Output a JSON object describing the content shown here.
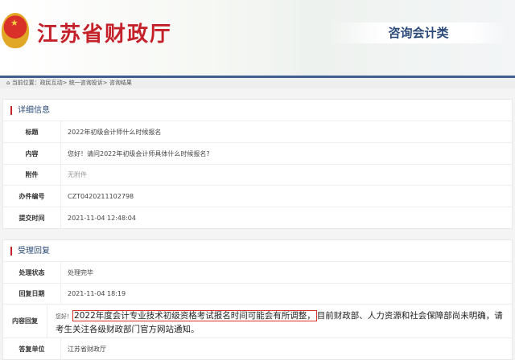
{
  "header": {
    "site_title": "江苏省财政厅",
    "category": "咨询会计类"
  },
  "breadcrumb": {
    "icon": "home-icon",
    "text": "当前位置：政民互动> 统一咨询投诉> 咨询结果"
  },
  "detail": {
    "title": "详细信息",
    "rows": [
      {
        "label": "标题",
        "value": "2022年初级会计师什么时候报名"
      },
      {
        "label": "内容",
        "value": "您好！请问2022年初级会计师具体什么时候报名?"
      },
      {
        "label": "附件",
        "value": "无附件"
      },
      {
        "label": "办件编号",
        "value": "CZT0420211102798"
      },
      {
        "label": "提交时间",
        "value": "2021-11-04 12:48:04"
      }
    ]
  },
  "reply": {
    "title": "受理回复",
    "rows": [
      {
        "label": "处理状态",
        "value": "处理完毕"
      },
      {
        "label": "回复日期",
        "value": "2021-11-04 18:19"
      },
      {
        "label": "内容回复",
        "greeting": "您好！",
        "highlight": "2022年度会计专业技术初级资格考试报名时间可能会有所调整，",
        "rest": "目前财政部、人力资源和社会保障部尚未明确，请考生关注各级财政部门官方网站通知。"
      },
      {
        "label": "答复单位",
        "value": "江苏省财政厅"
      }
    ]
  },
  "colors": {
    "accent": "#c4212b",
    "navy": "#2c4b7a",
    "highlight_box": "#d9302a"
  }
}
